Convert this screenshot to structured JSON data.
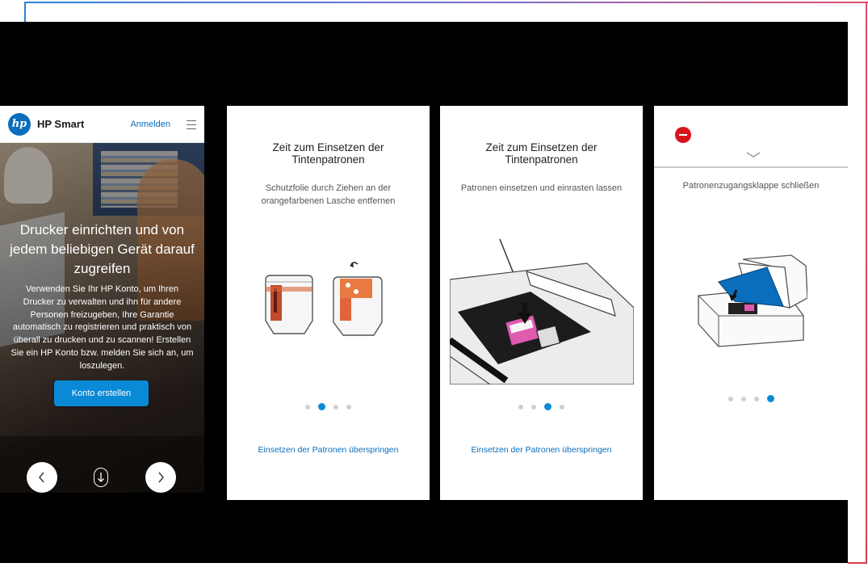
{
  "colors": {
    "hp_blue": "#0a6ebd",
    "button_blue": "#0a8ad6",
    "danger_red": "#d8141e",
    "background": "#000000"
  },
  "panel1": {
    "brand": "HP Smart",
    "logo_text": "hp",
    "login_link": "Anmelden",
    "menu_icon": "hamburger-icon",
    "hero": {
      "title": "Drucker einrichten und von jedem beliebigen Gerät darauf zugreifen",
      "text": "Verwenden Sie Ihr HP Konto, um Ihren Drucker zu verwalten und ihn für andere Personen freizugeben, Ihre Garantie automatisch zu registrieren und praktisch von überall zu drucken und zu scannen! Erstellen Sie ein HP Konto bzw. melden Sie sich an, um loszulegen.",
      "button": "Konto erstellen",
      "prev_icon": "chevron-left-icon",
      "next_icon": "chevron-right-icon",
      "scroll_icon": "scroll-down-icon"
    }
  },
  "panel2": {
    "title_line1": "Zeit zum Einsetzen der",
    "title_line2": "Tintenpatronen",
    "subtitle_line1": "Schutzfolie durch Ziehen an der",
    "subtitle_line2": "orangefarbenen Lasche entfernen",
    "active_step": 2,
    "total_steps": 4,
    "skip_link": "Einsetzen der Patronen überspringen"
  },
  "panel3": {
    "title_line1": "Zeit zum Einsetzen der",
    "title_line2": "Tintenpatronen",
    "subtitle": "Patronen einsetzen und einrasten lassen",
    "active_step": 3,
    "total_steps": 4,
    "skip_link": "Einsetzen der Patronen überspringen"
  },
  "panel4": {
    "close_icon": "minus-circle-icon",
    "collapse_icon": "chevron-down-icon",
    "subtitle": "Patronenzugangsklappe schließen",
    "active_step": 4,
    "total_steps": 4
  }
}
